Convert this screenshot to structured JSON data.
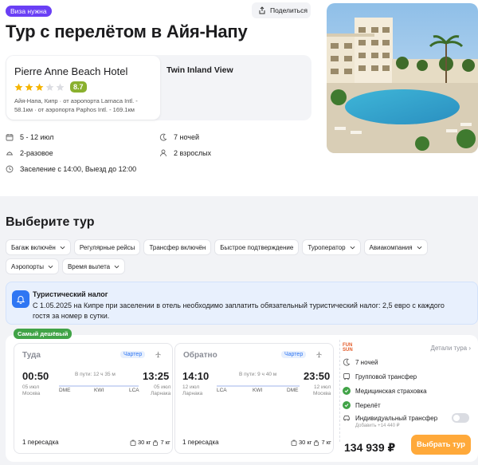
{
  "header": {
    "visa_badge": "Виза нужна",
    "share_label": "Поделиться",
    "title": "Тур с перелётом в Айя-Напу"
  },
  "hotel": {
    "name": "Pierre Anne Beach Hotel",
    "stars": 3,
    "stars_max": 5,
    "rating": "8.7",
    "location_line1": "Айя-Напа, Кипр · от аэропорта Larnaca Intl. -",
    "location_line2": "58.1км · от аэропорта Paphos Intl. - 169.1км",
    "room": "Twin Inland View"
  },
  "details": {
    "dates": "5 - 12 июл",
    "nights": "7 ночей",
    "meals": "2-разовое",
    "guests": "2 взрослых",
    "checkin": "Заселение с 14:00, Выезд до 12:00"
  },
  "section_title": "Выберите тур",
  "filters": [
    {
      "label": "Багаж включён",
      "dropdown": true
    },
    {
      "label": "Регулярные рейсы",
      "dropdown": false
    },
    {
      "label": "Трансфер включён",
      "dropdown": false
    },
    {
      "label": "Быстрое подтверждение",
      "dropdown": false
    },
    {
      "label": "Туроператор",
      "dropdown": true
    },
    {
      "label": "Авиакомпания",
      "dropdown": true
    },
    {
      "label": "Аэропорты",
      "dropdown": true
    },
    {
      "label": "Время вылета",
      "dropdown": true
    }
  ],
  "tax": {
    "title": "Туристический налог",
    "text": "С 1.05.2025 на Кипре при заселении в отель необходимо заплатить обязательный туристический налог: 2,5 евро с каждого гостя за номер в сутки."
  },
  "offer": {
    "badge": "Самый дешёвый",
    "outbound": {
      "title": "Туда",
      "charter": "Чартер",
      "dep_time": "00:50",
      "dep_date": "05 июл",
      "dep_city": "Москва",
      "arr_time": "13:25",
      "arr_date": "05 июл",
      "arr_city": "Ларнака",
      "duration": "В пути: 12 ч 35 м",
      "codes": [
        "DME",
        "KWI",
        "LCA"
      ],
      "transfers": "1 пересадка",
      "bag": "30 кг",
      "hand": "7 кг"
    },
    "return": {
      "title": "Обратно",
      "charter": "Чартер",
      "dep_time": "14:10",
      "dep_date": "12 июл",
      "dep_city": "Ларнака",
      "arr_time": "23:50",
      "arr_date": "12 июл",
      "arr_city": "Москва",
      "duration": "В пути: 9 ч 40 м",
      "codes": [
        "LCA",
        "KWI",
        "DME"
      ],
      "transfers": "1 пересадка",
      "bag": "30 кг",
      "hand": "7 кг"
    },
    "operator_logo_line1": "FUN",
    "operator_logo_line2": "SUN",
    "details_link": "Детали тура",
    "features": {
      "nights": "7 ночей",
      "group_transfer": "Групповой трансфер",
      "insurance": "Медицинская страховка",
      "flight": "Перелёт",
      "individual_transfer": "Индивидуальный трансфер",
      "individual_price": "Добавить +14 440 ₽"
    },
    "price": "134 939 ₽",
    "select_label": "Выбрать тур"
  }
}
